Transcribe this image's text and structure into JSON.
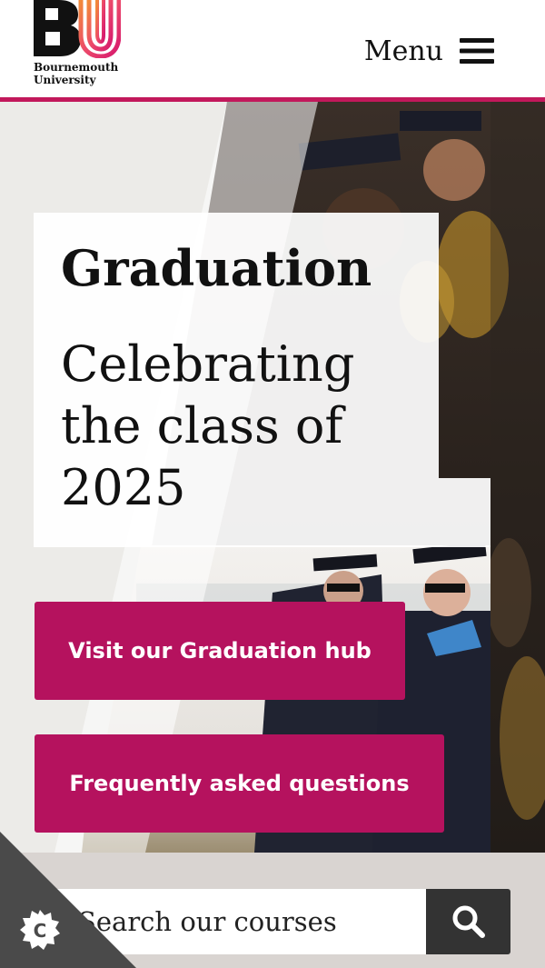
{
  "header": {
    "logo": {
      "mark": "BU",
      "line1": "Bournemouth",
      "line2": "University"
    },
    "menu_label": "Menu",
    "menu_icon": "hamburger-icon",
    "accent_color": "#c2185b"
  },
  "hero": {
    "heading": "Graduation",
    "subheading": "Celebrating the class of 2025",
    "buttons": [
      {
        "label": "Visit our Graduation hub"
      },
      {
        "label": "Frequently asked questions"
      }
    ],
    "button_color": "#b5125e"
  },
  "search": {
    "placeholder": "Search our courses",
    "button_icon": "search-icon",
    "button_color": "#333333"
  },
  "cookie": {
    "icon": "cookie-settings-icon",
    "letter": "C"
  }
}
